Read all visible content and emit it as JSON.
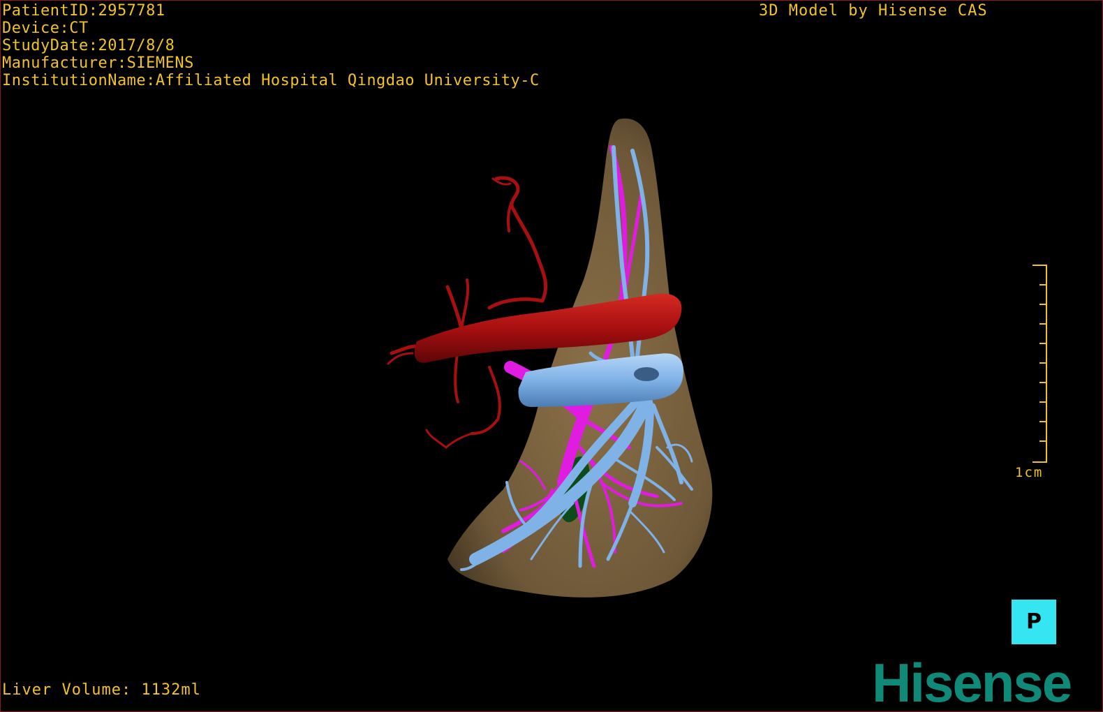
{
  "patient_info": {
    "patient_id": "PatientID:2957781",
    "device": "Device:CT",
    "study_date": "StudyDate:2017/8/8",
    "manufacturer": "Manufacturer:SIEMENS",
    "institution": "InstitutionName:Affiliated Hospital Qingdao University-C"
  },
  "model_credit": "3D Model by Hisense CAS",
  "measurements": {
    "liver_volume": "Liver Volume: 1132ml"
  },
  "scale_bar": {
    "label": "1cm"
  },
  "orientation_cube": {
    "label": "P"
  },
  "brand": {
    "logo_text": "Hisense"
  },
  "colors": {
    "text": "#f2c22a",
    "liver": "#7a6440",
    "artery": "#b01414",
    "portal_vein": "#7fb2e6",
    "hepatic_vein": "#e01ce0",
    "gallbladder": "#0e4a1a",
    "orientation_cube": "#35e6f2",
    "logo": "#0f8a78",
    "border": "#8a1a22"
  },
  "icons": {
    "orientation": "orientation-cube-icon",
    "scale": "scale-bar-icon"
  }
}
